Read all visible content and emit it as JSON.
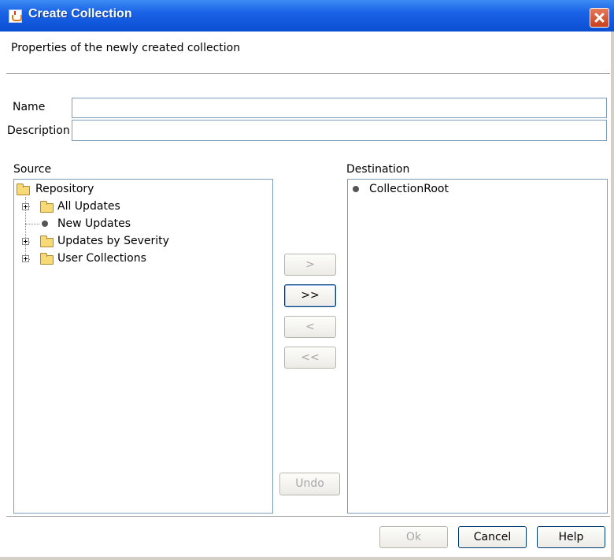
{
  "window": {
    "title": "Create Collection"
  },
  "header": {
    "description": "Properties of the newly created collection"
  },
  "form": {
    "name_label": "Name",
    "name_value": "",
    "description_label": "Description",
    "description_value": ""
  },
  "source": {
    "label": "Source",
    "root": "Repository",
    "items": [
      "All Updates",
      "New Updates",
      "Updates by Severity",
      "User Collections"
    ]
  },
  "destination": {
    "label": "Destination",
    "items": [
      "CollectionRoot"
    ]
  },
  "transfer_buttons": {
    "add": ">",
    "add_all": ">>",
    "remove": "<",
    "remove_all": "<<",
    "undo": "Undo"
  },
  "footer": {
    "ok": "Ok",
    "cancel": "Cancel",
    "help": "Help"
  }
}
